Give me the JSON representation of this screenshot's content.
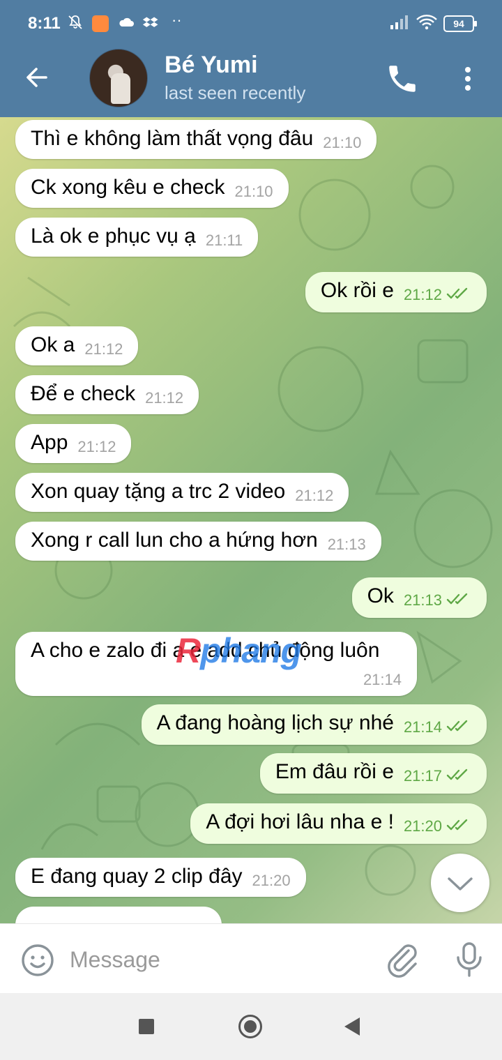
{
  "status_bar": {
    "time": "8:11",
    "battery": "94",
    "icons": [
      "mute-bell-icon",
      "app-notification-icon",
      "cloud-icon",
      "dropbox-icon",
      "more-dots-icon",
      "signal-icon",
      "wifi-icon",
      "battery-icon"
    ]
  },
  "header": {
    "name": "Bé Yumi",
    "status": "last seen recently",
    "color": "#517da2"
  },
  "messages": [
    {
      "dir": "in",
      "text": "Thì e không làm thất vọng đâu",
      "time": "21:10"
    },
    {
      "dir": "in",
      "text": "Ck xong kêu e check",
      "time": "21:10"
    },
    {
      "dir": "in",
      "text": "Là ok e phục vụ ạ",
      "time": "21:11"
    },
    {
      "dir": "out",
      "text": "Ok rồi e",
      "time": "21:12"
    },
    {
      "dir": "in",
      "text": "Ok a",
      "time": "21:12"
    },
    {
      "dir": "in",
      "text": "Để e check",
      "time": "21:12"
    },
    {
      "dir": "in",
      "text": "App",
      "time": "21:12"
    },
    {
      "dir": "in",
      "text": "Xon quay tặng a trc 2 video",
      "time": "21:12"
    },
    {
      "dir": "in",
      "text": "Xong r call lun cho a hứng hơn",
      "time": "21:13"
    },
    {
      "dir": "out",
      "text": "Ok",
      "time": "21:13"
    },
    {
      "dir": "in",
      "text": "A cho e zalo đi a e add chủ động luôn",
      "time": "21:14"
    },
    {
      "dir": "out",
      "text": "A đang hoàng lịch sự nhé",
      "time": "21:14"
    },
    {
      "dir": "out",
      "text": "Em đâu rồi e",
      "time": "21:17"
    },
    {
      "dir": "out",
      "text": "A đợi hơi lâu nha e !",
      "time": "21:20"
    },
    {
      "dir": "in",
      "text": "E đang quay 2 clip đây",
      "time": "21:20"
    }
  ],
  "watermark": {
    "part1": "R",
    "part2": "phang"
  },
  "input": {
    "placeholder": "Message",
    "value": ""
  },
  "colors": {
    "incoming": "#ffffff",
    "outgoing": "#effdde",
    "outgoing_time": "#5fa846",
    "accent": "#517da2"
  }
}
